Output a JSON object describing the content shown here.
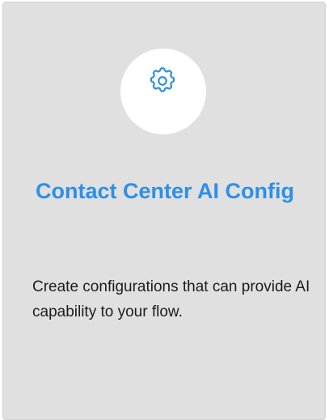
{
  "card": {
    "icon": "gear-icon",
    "title": "Contact Center AI Config",
    "description": "Create configurations that can provide AI capability to your flow."
  },
  "colors": {
    "card_background": "#e0e0e0",
    "title": "#2d8fe8",
    "icon": "#2d8fe8",
    "description": "#1c1c1c"
  }
}
